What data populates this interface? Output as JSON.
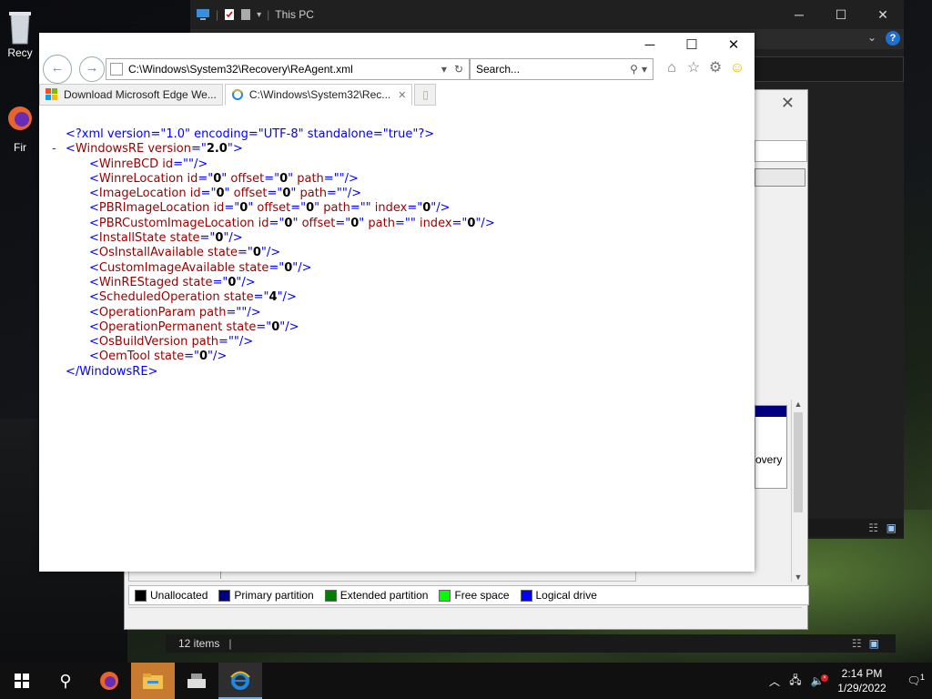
{
  "desktop": {
    "icons": [
      {
        "label": "Recy",
        "name": "recycle-bin"
      },
      {
        "label": "Fir",
        "name": "firefox"
      }
    ]
  },
  "explorer": {
    "title": "This PC",
    "status": "12 items"
  },
  "disk_mgmt": {
    "legend": [
      {
        "label": "Unallocated",
        "color": "#000000"
      },
      {
        "label": "Primary partition",
        "color": "#000080"
      },
      {
        "label": "Extended partition",
        "color": "#008000"
      },
      {
        "label": "Free space",
        "color": "#00ff00"
      },
      {
        "label": "Logical drive",
        "color": "#0000ff"
      }
    ],
    "partial_label": "overy"
  },
  "ie": {
    "address": "C:\\Windows\\System32\\Recovery\\ReAgent.xml",
    "search_placeholder": "Search...",
    "tabs": [
      {
        "label": "Download Microsoft Edge We..."
      },
      {
        "label": "C:\\Windows\\System32\\Rec..."
      }
    ]
  },
  "xml": {
    "declaration": "<?xml version=\"1.0\" encoding=\"UTF-8\" standalone=\"true\"?>",
    "root_open": "WindowsRE",
    "root_attr": "version",
    "root_val": "2.0",
    "root_close": "</WindowsRE>"
  },
  "taskbar": {
    "time": "2:14 PM",
    "date": "1/29/2022",
    "notification_count": "1"
  }
}
